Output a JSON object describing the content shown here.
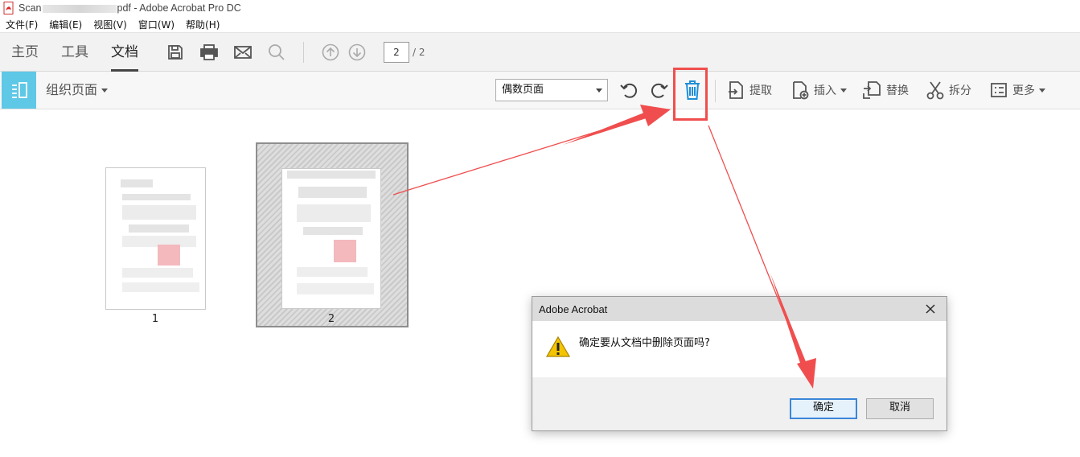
{
  "window": {
    "title_prefix": "Scan",
    "title_suffix": "pdf - Adobe Acrobat Pro DC"
  },
  "menu": {
    "items": [
      "文件(F)",
      "编辑(E)",
      "视图(V)",
      "窗口(W)",
      "帮助(H)"
    ]
  },
  "main_toolbar": {
    "tabs": [
      "主页",
      "工具",
      "文档"
    ],
    "active_tab": "文档",
    "current_page": "2",
    "total_pages": "/ 2"
  },
  "organize": {
    "label": "组织页面",
    "page_filter_value": "偶数页面",
    "extract_label": "提取",
    "insert_label": "插入",
    "replace_label": "替换",
    "split_label": "拆分",
    "more_label": "更多"
  },
  "thumbnails": [
    {
      "label": "1"
    },
    {
      "label": "2"
    }
  ],
  "dialog": {
    "title": "Adobe Acrobat",
    "message": "确定要从文档中删除页面吗?",
    "ok_label": "确定",
    "cancel_label": "取消"
  },
  "colors": {
    "accent": "#5ec8e6",
    "delete_icon": "#1e8fd8",
    "annotation": "#f04e4e"
  }
}
